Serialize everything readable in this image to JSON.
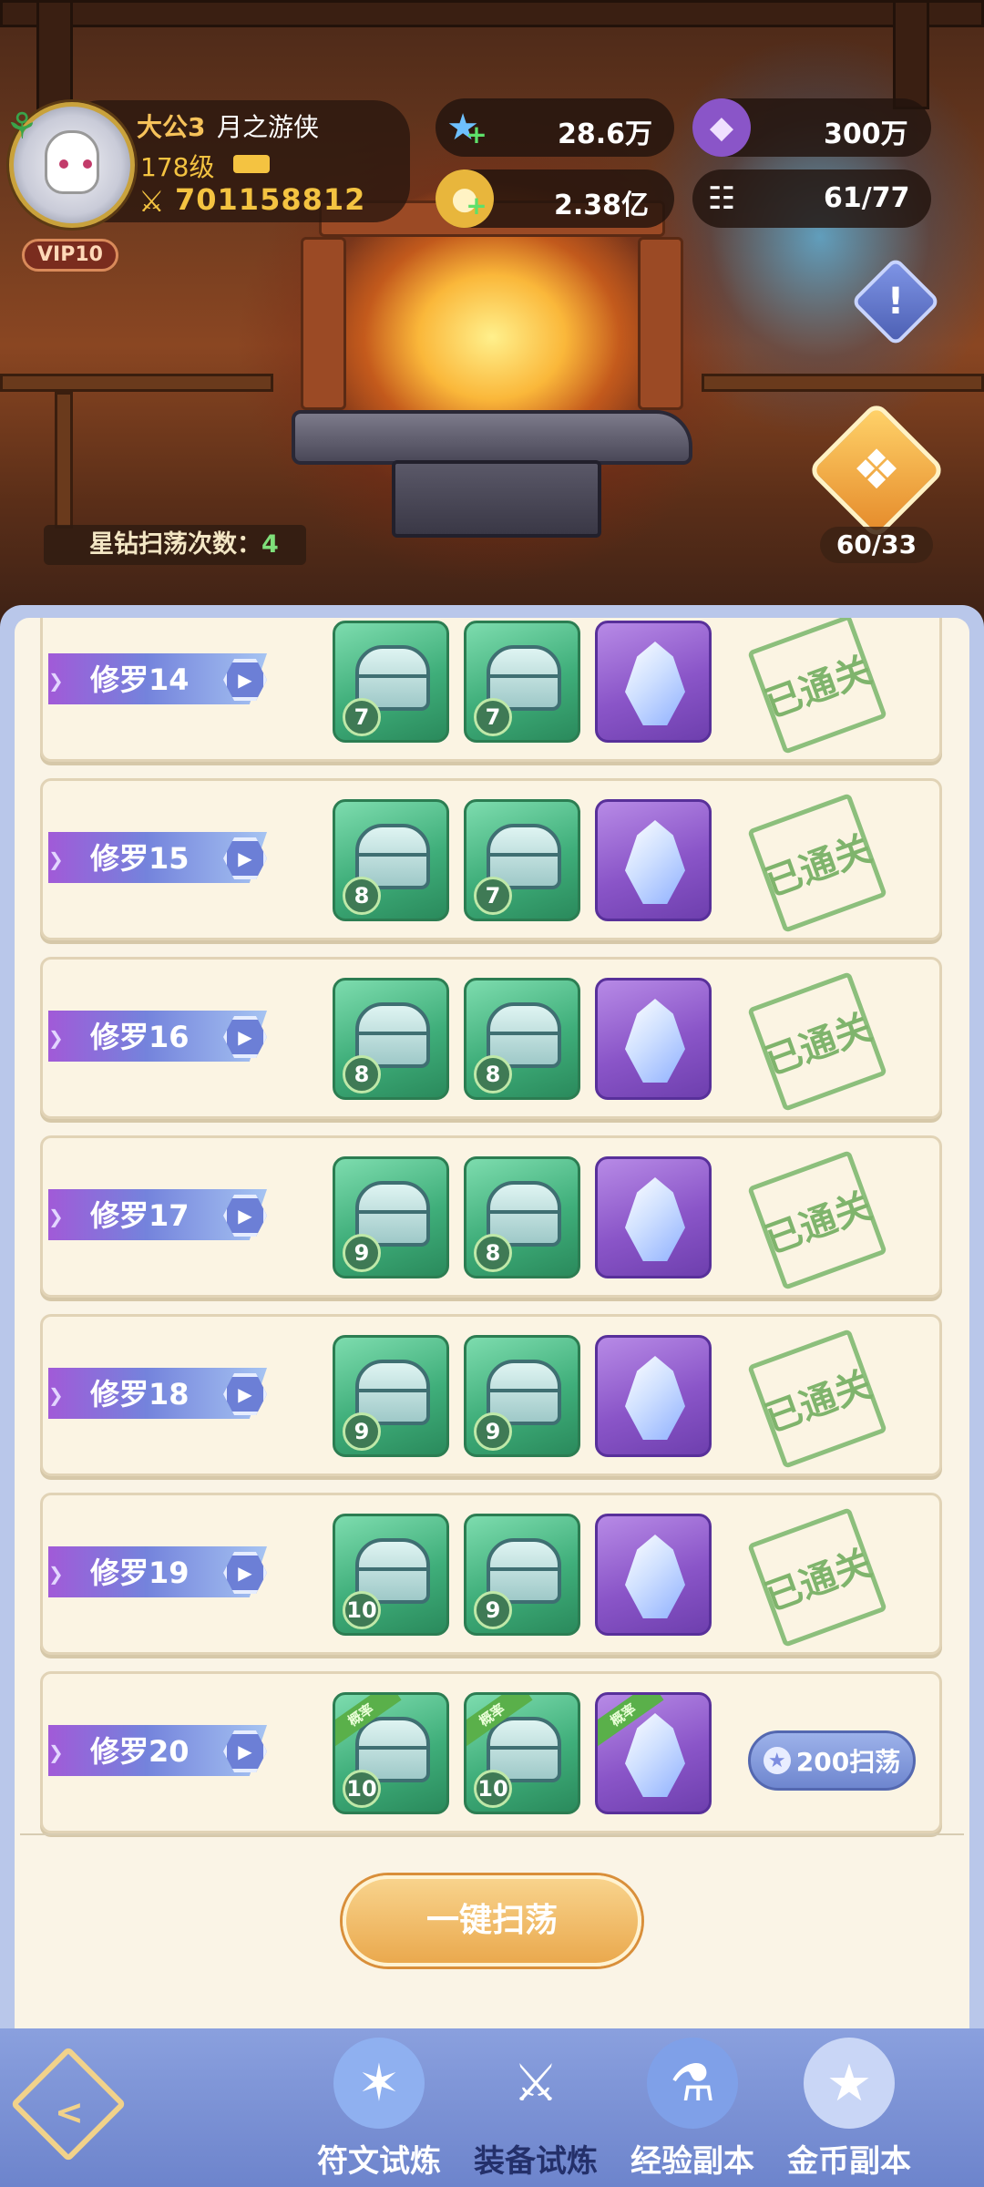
{
  "player": {
    "name": "大公3",
    "title": "月之游侠",
    "level": "178级",
    "power": "701158812",
    "vip": "VIP10"
  },
  "resources": {
    "stars": "28.6万",
    "gems": "300万",
    "gold": "2.38亿",
    "members": "61/77"
  },
  "forge": {
    "sweep_label": "星钻扫荡次数：",
    "sweep_count": "4",
    "gift_count": "60/33"
  },
  "stages": [
    {
      "name": "修罗14",
      "rewards": [
        "7",
        "7",
        ""
      ],
      "status": "已通关"
    },
    {
      "name": "修罗15",
      "rewards": [
        "8",
        "7",
        ""
      ],
      "status": "已通关"
    },
    {
      "name": "修罗16",
      "rewards": [
        "8",
        "8",
        ""
      ],
      "status": "已通关"
    },
    {
      "name": "修罗17",
      "rewards": [
        "9",
        "8",
        ""
      ],
      "status": "已通关"
    },
    {
      "name": "修罗18",
      "rewards": [
        "9",
        "9",
        ""
      ],
      "status": "已通关"
    },
    {
      "name": "修罗19",
      "rewards": [
        "10",
        "9",
        ""
      ],
      "status": "已通关"
    },
    {
      "name": "修罗20",
      "rewards": [
        "10",
        "10",
        ""
      ],
      "ribbon": "概率",
      "sweep_button": "200扫荡"
    }
  ],
  "oneclick_label": "一键扫荡",
  "nav": [
    {
      "label": "符文试炼",
      "icon": "rune-icon",
      "active": false
    },
    {
      "label": "装备试炼",
      "icon": "sword-icon",
      "active": true
    },
    {
      "label": "经验副本",
      "icon": "potion-icon",
      "active": false
    },
    {
      "label": "金币副本",
      "icon": "coin-icon",
      "active": false
    }
  ],
  "colors": {
    "accent": "#6d84cc",
    "panel": "#faf4e6",
    "gold": "#f4c341",
    "stamp": "#7fb46c"
  }
}
